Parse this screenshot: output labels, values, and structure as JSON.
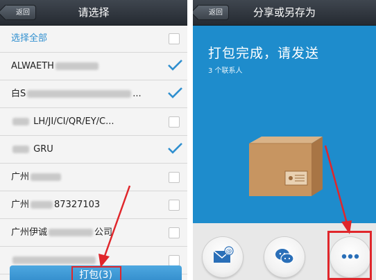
{
  "left_screen": {
    "back_label": "返回",
    "title": "请选择",
    "select_all_label": "选择全部",
    "contacts": [
      {
        "prefix": "ALWAETH",
        "suffix": "",
        "checked": true
      },
      {
        "prefix": "白S",
        "suffix": "...",
        "checked": true
      },
      {
        "prefix": "",
        "suffix": "LH/JI/CI/QR/EY/C...",
        "checked": false
      },
      {
        "prefix": "",
        "suffix": "GRU",
        "checked": true
      },
      {
        "prefix": "广州",
        "suffix": "",
        "checked": false
      },
      {
        "prefix": "广州",
        "suffix": "87327103",
        "checked": false
      },
      {
        "prefix": "广州伊诚",
        "suffix": "公司",
        "checked": false
      },
      {
        "prefix": "",
        "suffix": "",
        "checked": false
      }
    ],
    "pack_button_label": "打包(3)"
  },
  "right_screen": {
    "back_label": "返回",
    "title": "分享或另存为",
    "status_text": "打包完成，请发送",
    "contacts_count_text": "3 个联系人",
    "share_options": [
      {
        "icon": "email-icon"
      },
      {
        "icon": "wechat-icon"
      },
      {
        "icon": "more-icon"
      }
    ]
  },
  "colors": {
    "titlebar": "#2c3238",
    "accent_blue": "#1e8ccc",
    "annotation_red": "#e0262b",
    "check_blue": "#2f8fcf"
  }
}
